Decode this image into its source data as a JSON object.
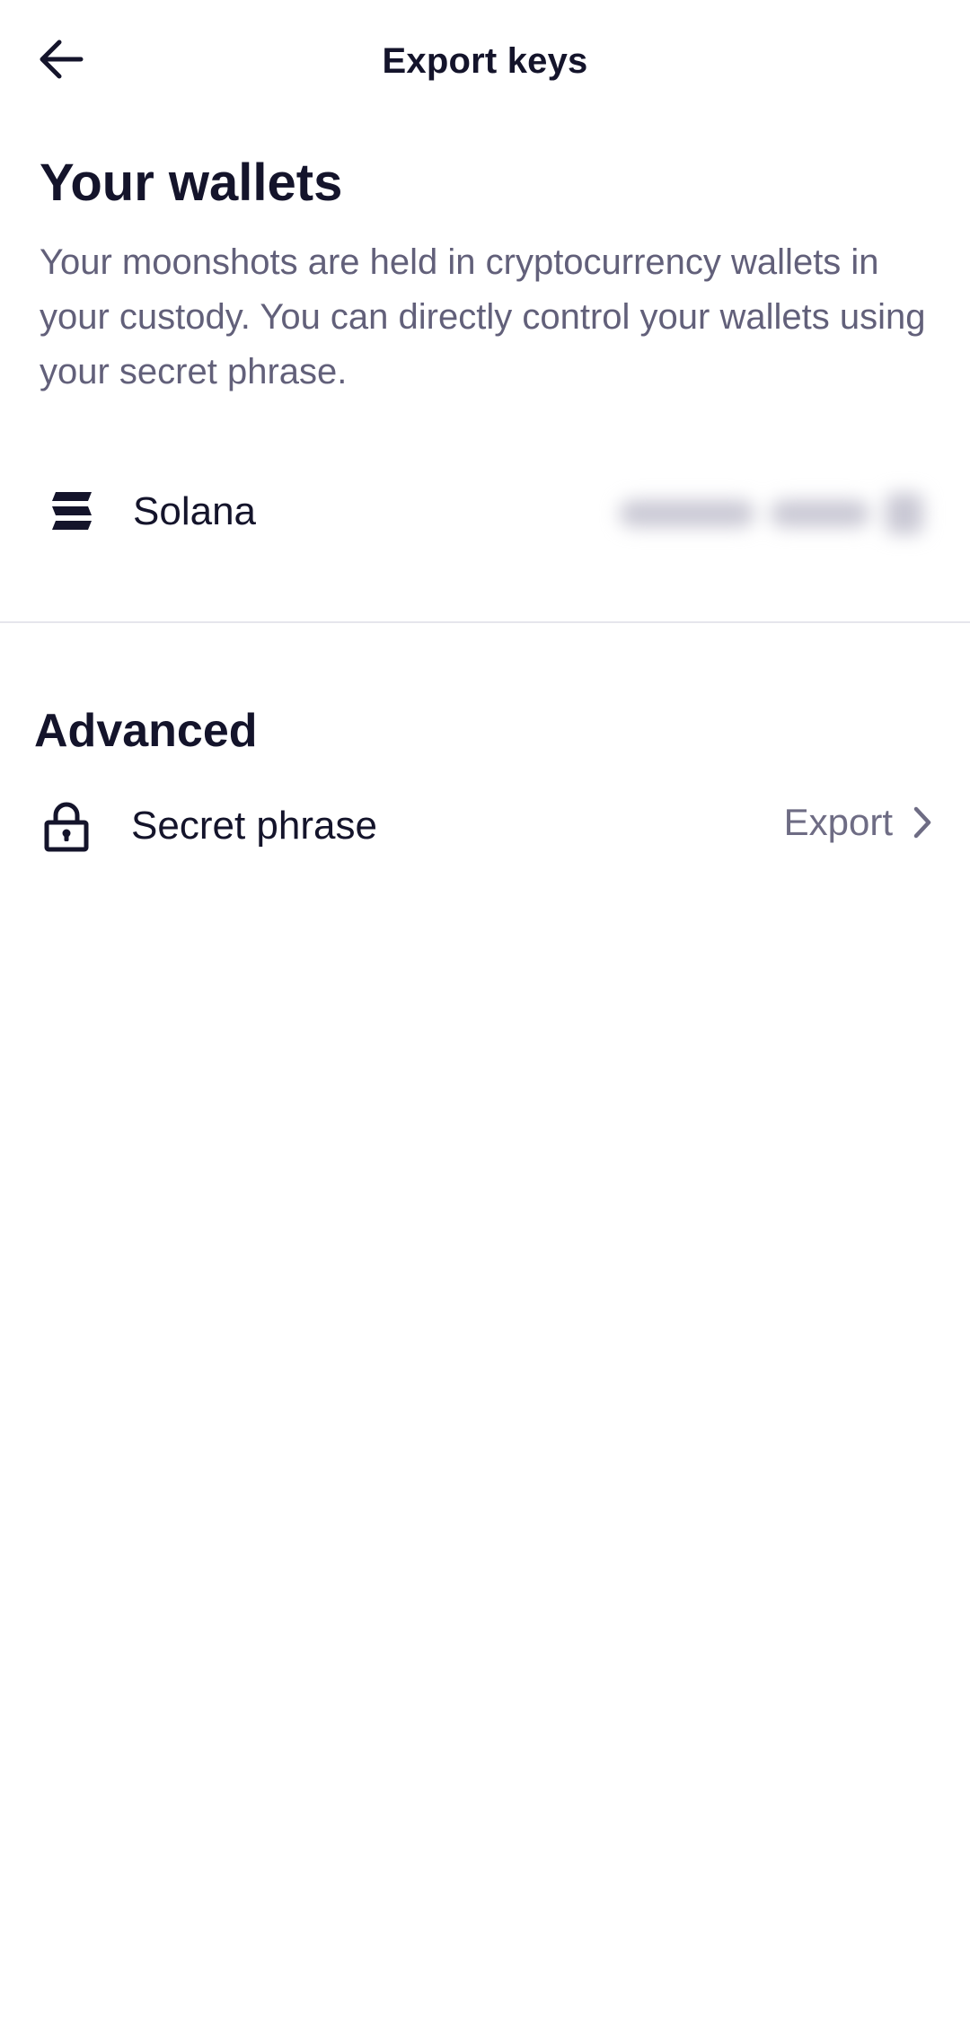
{
  "header": {
    "title": "Export keys",
    "back_icon": "arrow-left-icon"
  },
  "wallets": {
    "heading": "Your wallets",
    "description": "Your moonshots are held in cryptocurrency wallets in your custody. You can directly control your wallets using your secret phrase.",
    "items": [
      {
        "name": "Solana",
        "icon": "solana-icon",
        "address_redacted": true
      }
    ]
  },
  "advanced": {
    "heading": "Advanced",
    "secret_phrase": {
      "label": "Secret phrase",
      "icon": "lock-icon",
      "action_label": "Export",
      "action_icon": "chevron-right-icon"
    }
  },
  "colors": {
    "text_primary": "#14142b",
    "text_secondary": "#62607a",
    "action_text": "#6e6c84",
    "divider": "#e6e6ec",
    "background": "#ffffff"
  }
}
